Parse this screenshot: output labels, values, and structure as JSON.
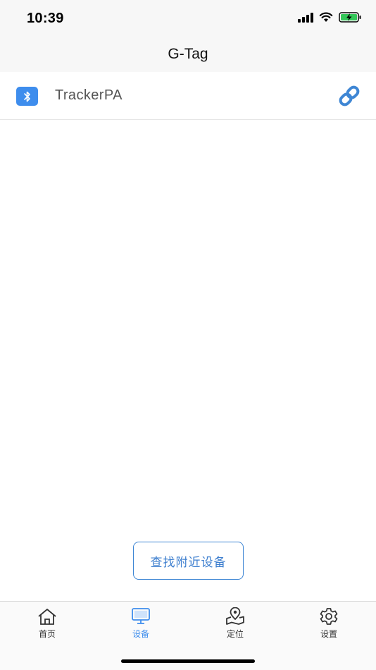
{
  "status_bar": {
    "time": "10:39"
  },
  "nav": {
    "title": "G-Tag"
  },
  "device": {
    "name": "TrackerPA",
    "icon": "bluetooth-icon",
    "action_icon": "link-icon"
  },
  "actions": {
    "scan_label": "查找附近设备"
  },
  "tabs": [
    {
      "label": "首页",
      "icon": "home-icon",
      "active": false
    },
    {
      "label": "设备",
      "icon": "monitor-icon",
      "active": true
    },
    {
      "label": "定位",
      "icon": "map-pin-icon",
      "active": false
    },
    {
      "label": "设置",
      "icon": "gear-icon",
      "active": false
    }
  ],
  "colors": {
    "accent": "#3e8ded",
    "battery": "#34c759"
  }
}
